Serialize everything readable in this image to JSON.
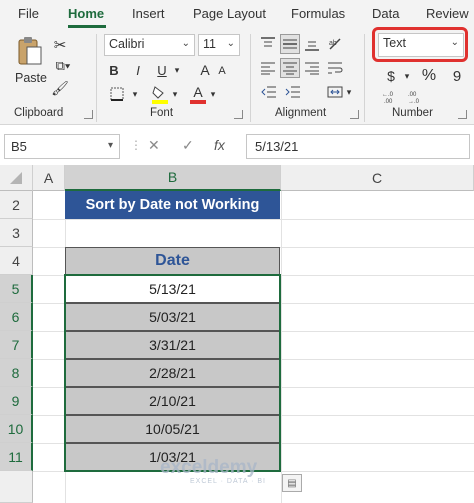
{
  "ribbon_tabs": [
    {
      "label": "File",
      "active": false
    },
    {
      "label": "Home",
      "active": true
    },
    {
      "label": "Insert",
      "active": false
    },
    {
      "label": "Page Layout",
      "active": false
    },
    {
      "label": "Formulas",
      "active": false
    },
    {
      "label": "Data",
      "active": false
    },
    {
      "label": "Review",
      "active": false
    }
  ],
  "clipboard": {
    "paste_label": "Paste",
    "group_label": "Clipboard"
  },
  "font": {
    "name": "Calibri",
    "size": "11",
    "bold": "B",
    "italic": "I",
    "underline": "U",
    "grow": "A",
    "shrink": "A",
    "group_label": "Font",
    "highlight_color": "#ffff00",
    "font_color": "#e0312f"
  },
  "alignment": {
    "group_label": "Alignment"
  },
  "number": {
    "format": "Text",
    "currency": "$",
    "percent": "%",
    "comma": "9",
    "group_label": "Number"
  },
  "formula_bar": {
    "name_box": "B5",
    "cancel": "✕",
    "enter": "✓",
    "fx": "fx",
    "value": "5/13/21"
  },
  "columns": [
    "A",
    "B",
    "C"
  ],
  "rows": [
    "2",
    "3",
    "4",
    "5",
    "6",
    "7",
    "8",
    "9",
    "10",
    "11"
  ],
  "sheet": {
    "title": "Sort by Date not Working",
    "header": "Date",
    "dates": [
      "5/13/21",
      "5/03/21",
      "3/31/21",
      "2/28/21",
      "2/10/21",
      "10/05/21",
      "1/03/21"
    ]
  },
  "watermark": {
    "name": "exceldemy",
    "tagline": "EXCEL · DATA · BI"
  },
  "colors": {
    "accent": "#1e6b3d",
    "title_fill": "#2e5597",
    "cell_fill": "#c8c8c8",
    "highlight": "#e0312f"
  }
}
